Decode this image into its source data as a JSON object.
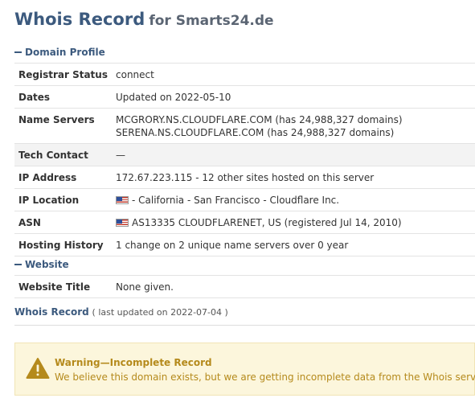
{
  "title": {
    "main": "Whois Record",
    "sub": "for Smarts24.de"
  },
  "domain_profile": {
    "heading": "Domain Profile",
    "rows": [
      {
        "key": "Registrar Status",
        "value": "connect"
      },
      {
        "key": "Dates",
        "value": "Updated on 2022-05-10"
      },
      {
        "key": "Name Servers",
        "value": "MCGRORY.NS.CLOUDFLARE.COM (has 24,988,327 domains)",
        "value2": "SERENA.NS.CLOUDFLARE.COM (has 24,988,327 domains)"
      },
      {
        "key": "Tech Contact",
        "value": "—"
      },
      {
        "key": "IP Address",
        "value": "172.67.223.115 - 12 other sites hosted on this server"
      },
      {
        "key": "IP Location",
        "value": "- California - San Francisco - Cloudflare Inc.",
        "flag": "us-flag-icon"
      },
      {
        "key": "ASN",
        "value": "AS13335 CLOUDFLARENET, US (registered Jul 14, 2010)",
        "flag": "us-flag-icon"
      },
      {
        "key": "Hosting History",
        "value": "1 change on 2 unique name servers over 0 year"
      }
    ]
  },
  "website": {
    "heading": "Website",
    "rows": [
      {
        "key": "Website Title",
        "value": "None given."
      }
    ]
  },
  "whois_record": {
    "link": "Whois Record",
    "note": "( last updated on 2022-07-04 )"
  },
  "warning": {
    "title": "Warning—Incomplete Record",
    "text": "We believe this domain exists, but we are getting incomplete data from the Whois server.",
    "icon": "warning-triangle-icon",
    "color": "#b58a1c",
    "background": "#fcf6dc"
  }
}
